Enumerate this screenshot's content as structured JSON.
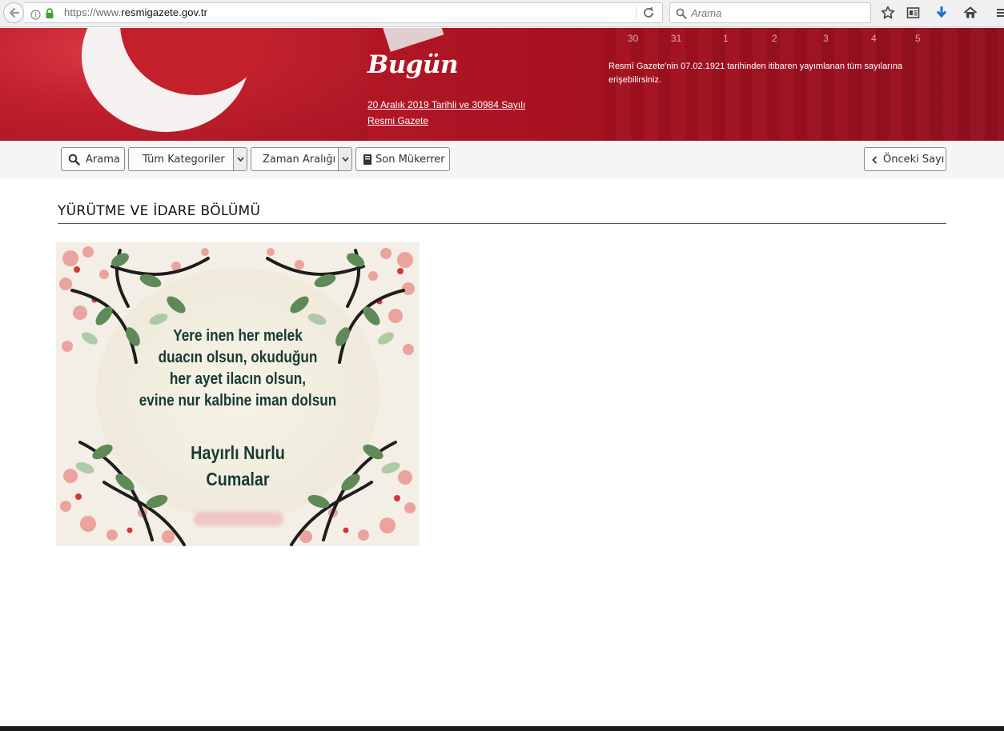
{
  "browser": {
    "url_prefix": "https://www.",
    "url_host": "resmigazete.gov.tr",
    "search_placeholder": "Arama"
  },
  "banner": {
    "days": [
      "30",
      "31",
      "1",
      "2",
      "3",
      "4",
      "5"
    ],
    "today_label": "Bugün",
    "issue_line1": "20 Aralık 2019 Tarihli ve 30984 Sayılı",
    "issue_line2": "Resmi Gazete",
    "info": "Resmî Gazete'nin 07.02.1921 tarihinden itibaren yayımlanan tüm sayılarına erişebilirsiniz."
  },
  "toolbar": {
    "search_label": "Arama",
    "category_label": "Tüm Kategoriler",
    "date_range_label": "Zaman Aralığı",
    "last_repeat_label": "Son Mükerrer",
    "previous_label": "Önceki Sayı"
  },
  "content": {
    "section_title": "YÜRÜTME VE İDARE BÖLÜMÜ",
    "card_lines": [
      "Yere inen her melek",
      "duacın olsun, okuduğun",
      "her ayet ilacın olsun,",
      "evine nur kalbine iman dolsun"
    ],
    "card_closing": [
      "Hayırlı Nurlu",
      "Cumalar"
    ]
  },
  "colors": {
    "banner_red": "#b31726",
    "card_text": "#173a35",
    "download_blue": "#1a73c9"
  },
  "icons": [
    "back-arrow-icon",
    "info-icon",
    "lock-icon",
    "reload-icon",
    "search-icon",
    "bookmark-star-icon",
    "reading-list-icon",
    "download-icon",
    "home-icon",
    "menu-icon",
    "chevron-left-icon",
    "caret-down-icon",
    "book-icon"
  ]
}
